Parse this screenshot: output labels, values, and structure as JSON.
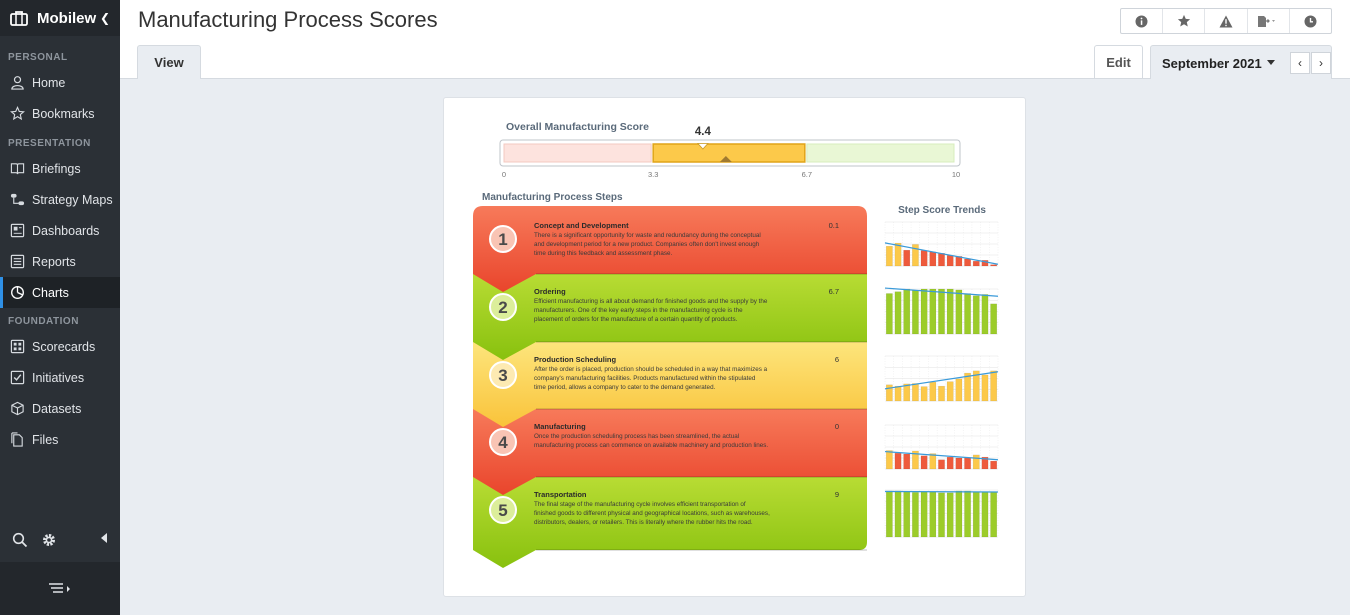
{
  "app": {
    "brand": "Mobilew"
  },
  "sidebar": {
    "sections": [
      {
        "label": "PERSONAL",
        "items": [
          {
            "label": "Home",
            "icon": "user-icon"
          },
          {
            "label": "Bookmarks",
            "icon": "star-icon"
          }
        ]
      },
      {
        "label": "PRESENTATION",
        "items": [
          {
            "label": "Briefings",
            "icon": "book-icon"
          },
          {
            "label": "Strategy Maps",
            "icon": "strategy-map-icon"
          },
          {
            "label": "Dashboards",
            "icon": "dashboard-icon"
          },
          {
            "label": "Reports",
            "icon": "report-icon"
          },
          {
            "label": "Charts",
            "icon": "pie-chart-icon",
            "active": true
          }
        ]
      },
      {
        "label": "FOUNDATION",
        "items": [
          {
            "label": "Scorecards",
            "icon": "scorecard-icon"
          },
          {
            "label": "Initiatives",
            "icon": "checkbox-icon"
          },
          {
            "label": "Datasets",
            "icon": "cube-icon"
          },
          {
            "label": "Files",
            "icon": "files-icon"
          }
        ]
      }
    ]
  },
  "header": {
    "title": "Manufacturing Process Scores",
    "tab_view": "View",
    "edit_label": "Edit",
    "period": "September 2021",
    "toolbar_icons": [
      "info-icon",
      "star-icon",
      "warning-icon",
      "export-icon",
      "history-icon"
    ]
  },
  "gauge": {
    "title": "Overall Manufacturing Score",
    "value": 4.4,
    "value_label": "4.4",
    "min": 0,
    "max": 10,
    "thresholds": [
      3.3,
      6.7
    ],
    "tick_labels": [
      "0",
      "3.3",
      "6.7",
      "10"
    ],
    "colors": {
      "low": "#fde3de",
      "mid": "#fcc94a",
      "high": "#e9f7d5",
      "mid_border": "#e0a418"
    }
  },
  "steps_title": "Manufacturing Process Steps",
  "trends_title": "Step Score Trends",
  "steps": [
    {
      "number": "1",
      "title": "Concept and Development",
      "score": "0.1",
      "status": "red",
      "text": [
        "There is a significant opportunity for waste and redundancy during the conceptual",
        "and development period for a new product. Companies often don't invest enough",
        "time during this feedback and assessment phase."
      ]
    },
    {
      "number": "2",
      "title": "Ordering",
      "score": "6.7",
      "status": "green",
      "text": [
        "Efficient manufacturing is all about demand for finished goods and the supply by the",
        "manufacturers. One of the key early steps in the manufacturing cycle is the",
        "placement of orders for the manufacture of a certain quantity of products."
      ]
    },
    {
      "number": "3",
      "title": "Production Scheduling",
      "score": "6",
      "status": "yellow",
      "text": [
        "After the order is placed, production should be scheduled in a way that maximizes a",
        "company's manufacturing facilities. Products manufactured within the stipulated",
        "time period, allows a company to cater to the demand generated."
      ]
    },
    {
      "number": "4",
      "title": "Manufacturing",
      "score": "0",
      "status": "red",
      "text": [
        "Once the production scheduling process has been streamlined, the actual",
        "manufacturing process can commence on available machinery and production lines."
      ]
    },
    {
      "number": "5",
      "title": "Transportation",
      "score": "9",
      "status": "green",
      "text": [
        "The final stage of the manufacturing cycle involves efficient transportation of",
        "finished goods to different physical and geographical locations, such as warehouses,",
        "distributors, dealers, or retailers. This is literally where the rubber hits the road."
      ]
    }
  ],
  "step_colors": {
    "red": {
      "top": "#f77a5a",
      "bottom": "#e9452c",
      "circle": "#f9c4b4"
    },
    "green": {
      "top": "#b8dc34",
      "bottom": "#88c10e",
      "circle": "#dcee9a"
    },
    "yellow": {
      "top": "#fde57c",
      "bottom": "#f9c33a",
      "circle": "#fdeab2"
    }
  },
  "trends": [
    {
      "values": [
        4.5,
        5.2,
        3.6,
        4.9,
        3.5,
        3.2,
        2.9,
        2.4,
        2.2,
        1.6,
        1.1,
        1.3,
        0.3
      ],
      "statuses": [
        "y",
        "y",
        "r",
        "y",
        "r",
        "r",
        "r",
        "r",
        "r",
        "r",
        "r",
        "r",
        "r"
      ]
    },
    {
      "values": [
        9.0,
        9.4,
        10.0,
        9.7,
        10.0,
        10.0,
        10.0,
        10.0,
        9.8,
        9.0,
        8.5,
        8.8,
        6.7
      ],
      "statuses": [
        "g",
        "g",
        "g",
        "g",
        "g",
        "g",
        "g",
        "g",
        "g",
        "g",
        "g",
        "g",
        "g"
      ]
    },
    {
      "values": [
        3.6,
        3.3,
        3.8,
        3.9,
        3.2,
        4.2,
        3.3,
        4.3,
        4.9,
        6.2,
        6.7,
        5.8,
        6.7
      ],
      "statuses": [
        "y",
        "y",
        "y",
        "y",
        "y",
        "y",
        "y",
        "y",
        "y",
        "y",
        "y",
        "y",
        "y"
      ]
    },
    {
      "values": [
        4.2,
        3.6,
        3.4,
        4.1,
        3.0,
        3.5,
        2.1,
        2.7,
        2.5,
        2.6,
        3.2,
        2.7,
        1.8
      ],
      "statuses": [
        "y",
        "r",
        "r",
        "y",
        "r",
        "y",
        "r",
        "r",
        "r",
        "r",
        "y",
        "r",
        "r"
      ]
    },
    {
      "values": [
        9.8,
        9.8,
        9.7,
        9.5,
        9.6,
        9.6,
        9.4,
        9.4,
        9.8,
        9.8,
        9.6,
        9.6,
        9.6
      ],
      "statuses": [
        "g",
        "g",
        "g",
        "g",
        "g",
        "g",
        "g",
        "g",
        "g",
        "g",
        "g",
        "g",
        "g"
      ]
    }
  ],
  "trend_colors": {
    "r": "#ee5a3c",
    "y": "#fcc94a",
    "g": "#9ccc2a",
    "line": "#3a9ad9",
    "grid": "#e2e2e2"
  }
}
